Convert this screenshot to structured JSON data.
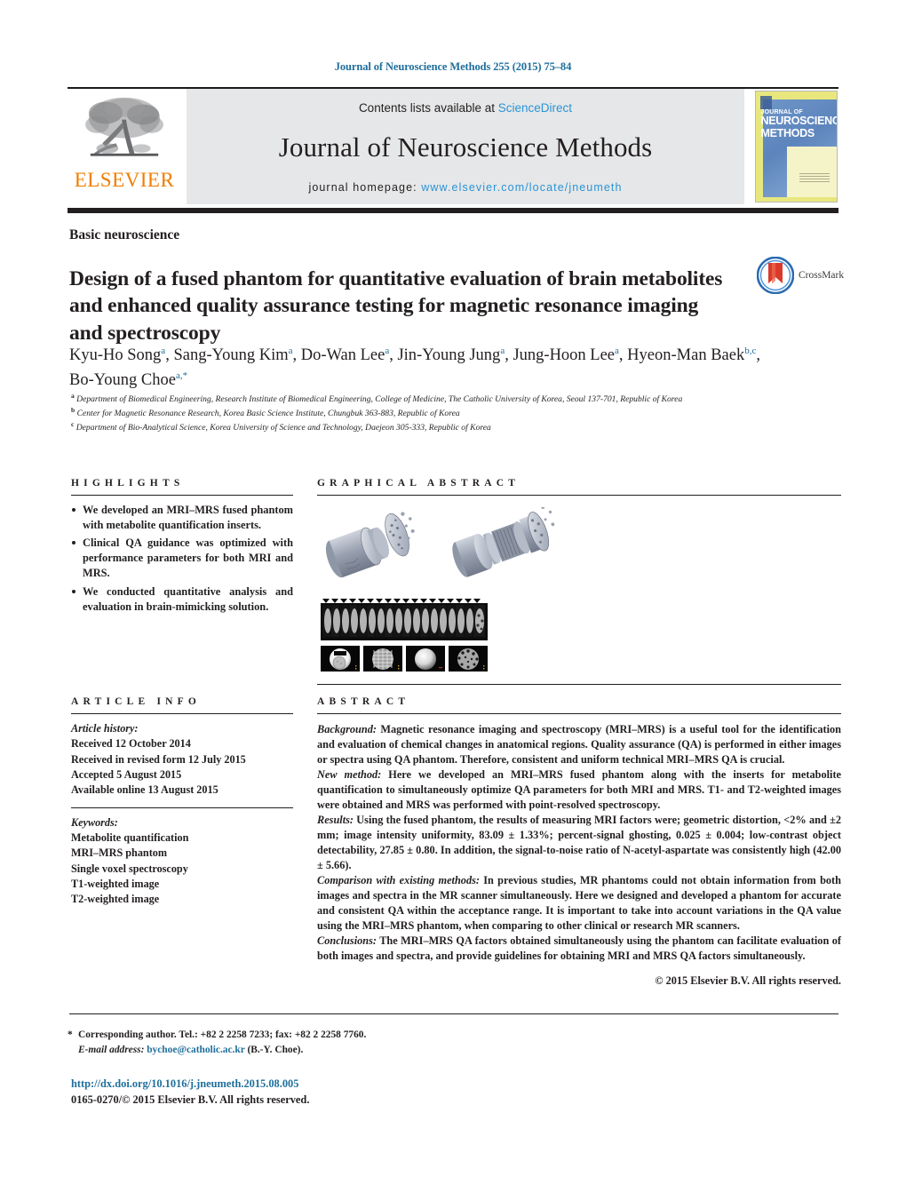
{
  "running_head": "Journal of Neuroscience Methods 255 (2015) 75–84",
  "masthead": {
    "contents_prefix": "Contents lists available at ",
    "sciencedirect": "ScienceDirect",
    "journal_title": "Journal of Neuroscience Methods",
    "homepage_prefix": "journal homepage: ",
    "homepage_url": "www.elsevier.com/locate/jneumeth",
    "publisher_wordmark": "ELSEVIER",
    "publisher_logo_icon": "elsevier-tree-icon",
    "cover_line1": "JOURNAL OF",
    "cover_line2": "NEUROSCIENCE",
    "cover_line3": "METHODS",
    "accent_blue": "#2a94d6",
    "elsevier_orange": "#f07d00",
    "band_gray": "#e6e7e8"
  },
  "article": {
    "section_label": "Basic neuroscience",
    "title": "Design of a fused phantom for quantitative evaluation of brain metabolites and enhanced quality assurance testing for magnetic resonance imaging and spectroscopy",
    "crossmark_label": "CrossMark",
    "authors": [
      {
        "name": "Kyu-Ho Song",
        "marks": "a",
        "sep": ", "
      },
      {
        "name": "Sang-Young Kim",
        "marks": "a",
        "sep": ", "
      },
      {
        "name": "Do-Wan Lee",
        "marks": "a",
        "sep": ", "
      },
      {
        "name": "Jin-Young Jung",
        "marks": "a",
        "sep": ", "
      },
      {
        "name": "Jung-Hoon Lee",
        "marks": "a",
        "sep": ", "
      },
      {
        "name": "Hyeon-Man Baek",
        "marks": "b,c",
        "sep": ", "
      },
      {
        "name": "Bo-Young Choe",
        "marks": "a,*",
        "sep": ""
      }
    ],
    "affiliations": [
      {
        "mark": "a",
        "text": "Department of Biomedical Engineering, Research Institute of Biomedical Engineering, College of Medicine, The Catholic University of Korea, Seoul 137-701, Republic of Korea"
      },
      {
        "mark": "b",
        "text": "Center for Magnetic Resonance Research, Korea Basic Science Institute, Chungbuk 363-883, Republic of Korea"
      },
      {
        "mark": "c",
        "text": "Department of Bio-Analytical Science, Korea University of Science and Technology, Daejeon 305-333, Republic of Korea"
      }
    ]
  },
  "highlights": {
    "heading": "HIGHLIGHTS",
    "items": [
      "We developed an MRI–MRS fused phantom with metabolite quantification inserts.",
      "Clinical QA guidance was optimized with performance parameters for both MRI and MRS.",
      "We conducted quantitative analysis and evaluation in brain-mimicking solution."
    ]
  },
  "graphical_abstract": {
    "heading": "GRAPHICAL ABSTRACT",
    "figure_description": "Exploded CAD renderings of two cylindrical MRI–MRS fused phantoms, a stack of axial MR slice images, and four MR phantom test images (resolution insert, grid/geometric distortion, uniformity, low-contrast object detectability)."
  },
  "article_info": {
    "heading": "ARTICLE INFO",
    "history_label": "Article history:",
    "history": [
      "Received 12 October 2014",
      "Received in revised form 12 July 2015",
      "Accepted 5 August 2015",
      "Available online 13 August 2015"
    ],
    "keywords_label": "Keywords:",
    "keywords": [
      "Metabolite quantification",
      "MRI–MRS phantom",
      "Single voxel spectroscopy",
      "T1-weighted image",
      "T2-weighted image"
    ]
  },
  "abstract": {
    "heading": "ABSTRACT",
    "paragraphs": [
      {
        "lead": "Background:",
        "text": " Magnetic resonance imaging and spectroscopy (MRI–MRS) is a useful tool for the identification and evaluation of chemical changes in anatomical regions. Quality assurance (QA) is performed in either images or spectra using QA phantom. Therefore, consistent and uniform technical MRI–MRS QA is crucial."
      },
      {
        "lead": "New method:",
        "text": " Here we developed an MRI–MRS fused phantom along with the inserts for metabolite quantification to simultaneously optimize QA parameters for both MRI and MRS. T1- and T2-weighted images were obtained and MRS was performed with point-resolved spectroscopy."
      },
      {
        "lead": "Results:",
        "text": " Using the fused phantom, the results of measuring MRI factors were; geometric distortion, <2% and ±2 mm; image intensity uniformity, 83.09 ± 1.33%; percent-signal ghosting, 0.025 ± 0.004; low-contrast object detectability, 27.85 ± 0.80. In addition, the signal-to-noise ratio of N-acetyl-aspartate was consistently high (42.00 ± 5.66)."
      },
      {
        "lead": "Comparison with existing methods:",
        "text": " In previous studies, MR phantoms could not obtain information from both images and spectra in the MR scanner simultaneously. Here we designed and developed a phantom for accurate and consistent QA within the acceptance range. It is important to take into account variations in the QA value using the MRI–MRS phantom, when comparing to other clinical or research MR scanners."
      },
      {
        "lead": "Conclusions:",
        "text": " The MRI–MRS QA factors obtained simultaneously using the phantom can facilitate evaluation of both images and spectra, and provide guidelines for obtaining MRI and MRS QA factors simultaneously."
      }
    ],
    "copyright": "© 2015 Elsevier B.V. All rights reserved."
  },
  "footer": {
    "corresponding_marker": "*",
    "corresponding_text": "Corresponding author. Tel.: +82 2 2258 7233; fax: +82 2 2258 7760.",
    "email_label": "E-mail address:",
    "email": "bychoe@catholic.ac.kr",
    "email_suffix": "(B.-Y. Choe).",
    "doi_url": "http://dx.doi.org/10.1016/j.jneumeth.2015.08.005",
    "issn_line": "0165-0270/© 2015 Elsevier B.V. All rights reserved."
  }
}
